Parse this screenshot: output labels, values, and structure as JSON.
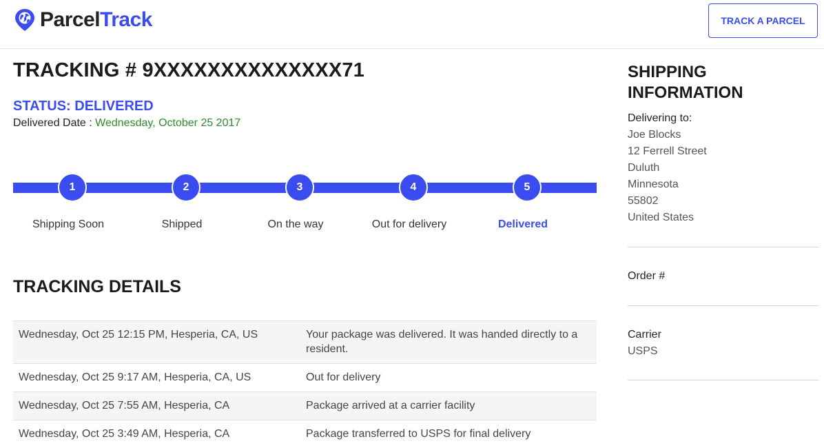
{
  "header": {
    "logo_word1": "Parcel",
    "logo_word2": "Track",
    "logo_icon": "globe-pin-icon",
    "cta_label": "TRACK A PARCEL"
  },
  "tracking": {
    "title": "TRACKING # 9XXXXXXXXXXXXXX71",
    "status": "STATUS: DELIVERED",
    "delivered_date_label": "Delivered Date :",
    "delivered_date_value": "Wednesday, October 25 2017"
  },
  "progress": {
    "current_step": 5,
    "steps": [
      {
        "number": "1",
        "label": "Shipping Soon"
      },
      {
        "number": "2",
        "label": "Shipped"
      },
      {
        "number": "3",
        "label": "On the way"
      },
      {
        "number": "4",
        "label": "Out for delivery"
      },
      {
        "number": "5",
        "label": "Delivered"
      }
    ]
  },
  "details": {
    "title": "TRACKING DETAILS",
    "rows": [
      {
        "when": "Wednesday, Oct 25 12:15 PM, Hesperia, CA, US",
        "event": "Your package was delivered. It was handed directly to a resident."
      },
      {
        "when": "Wednesday, Oct 25 9:17 AM, Hesperia, CA, US",
        "event": "Out for delivery"
      },
      {
        "when": "Wednesday, Oct 25 7:55 AM, Hesperia, CA",
        "event": "Package arrived at a carrier facility"
      },
      {
        "when": "Wednesday, Oct 25 3:49 AM, Hesperia, CA",
        "event": "Package transferred to USPS for final delivery"
      }
    ]
  },
  "shipping": {
    "title": "SHIPPING INFORMATION",
    "delivering_to_label": "Delivering to:",
    "name": "Joe Blocks",
    "street": "12 Ferrell Street",
    "city": "Duluth",
    "state": "Minnesota",
    "zip": "55802",
    "country": "United States",
    "order_label": "Order #",
    "order_value": "",
    "carrier_label": "Carrier",
    "carrier_value": "USPS"
  },
  "colors": {
    "accent": "#3a4cf0",
    "delivered_date": "#2e8b2e"
  }
}
